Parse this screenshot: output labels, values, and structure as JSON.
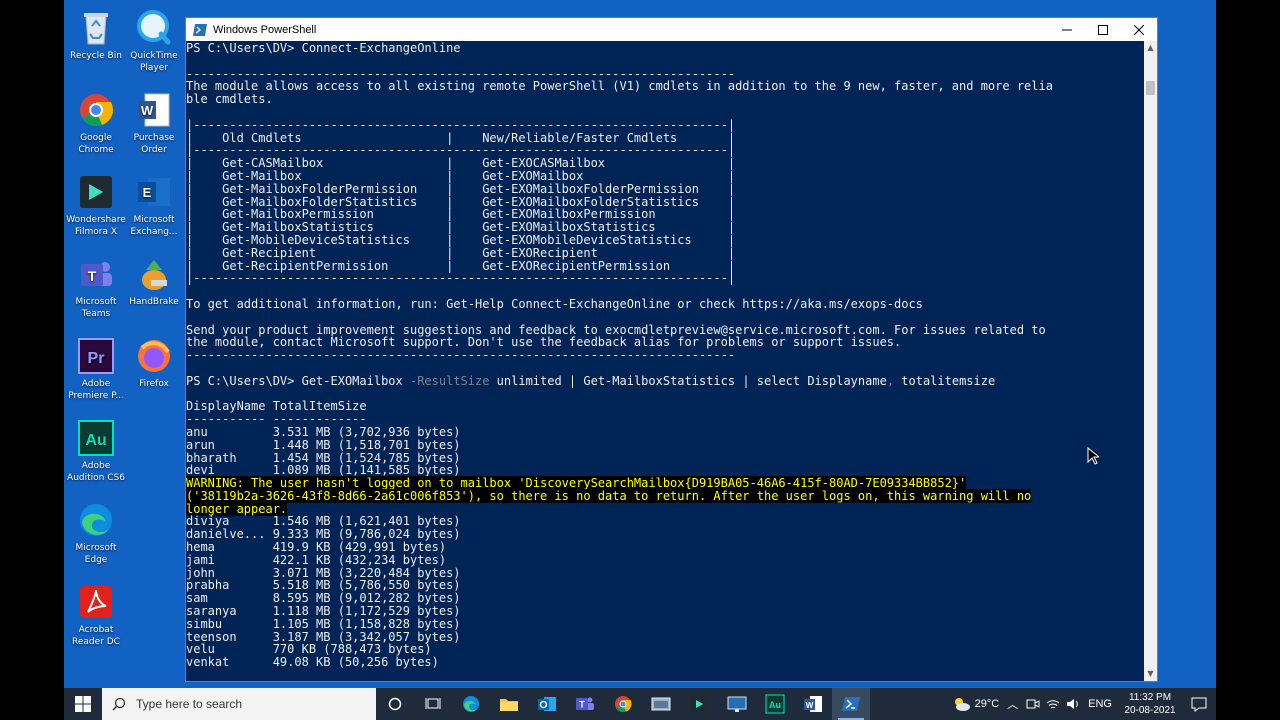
{
  "desktop": {
    "icons": [
      {
        "label": "Recycle Bin"
      },
      {
        "label": "QuickTime Player"
      },
      {
        "label": "Google Chrome"
      },
      {
        "label": "Purchase Order"
      },
      {
        "label": "Wondershare Filmora X"
      },
      {
        "label": "Microsoft Exchang..."
      },
      {
        "label": "Microsoft Teams"
      },
      {
        "label": "HandBrake"
      },
      {
        "label": "Adobe Premiere P..."
      },
      {
        "label": "Firefox"
      },
      {
        "label": "Adobe Audition CS6"
      },
      {
        "label": "Microsoft Edge"
      },
      {
        "label": "Acrobat Reader DC"
      }
    ]
  },
  "window": {
    "title": "Windows PowerShell",
    "minimize": "–",
    "maximize": "☐",
    "close": "✕"
  },
  "console": {
    "prompt1": "PS C:\\Users\\DV> Connect-ExchangeOnline",
    "dash_line": "----------------------------------------------------------------------------",
    "module_info_1": "The module allows access to all existing remote PowerShell (V1) cmdlets in addition to the 9 new, faster, and more relia",
    "module_info_2": "ble cmdlets.",
    "table_border": "|--------------------------------------------------------------------------|",
    "table_header": "|    Old Cmdlets                    |    New/Reliable/Faster Cmdlets       |",
    "table_rows": [
      "|    Get-CASMailbox                 |    Get-EXOCASMailbox                 |",
      "|    Get-Mailbox                    |    Get-EXOMailbox                    |",
      "|    Get-MailboxFolderPermission    |    Get-EXOMailboxFolderPermission    |",
      "|    Get-MailboxFolderStatistics    |    Get-EXOMailboxFolderStatistics    |",
      "|    Get-MailboxPermission          |    Get-EXOMailboxPermission          |",
      "|    Get-MailboxStatistics          |    Get-EXOMailboxStatistics          |",
      "|    Get-MobileDeviceStatistics     |    Get-EXOMobileDeviceStatistics     |",
      "|    Get-Recipient                  |    Get-EXORecipient                  |",
      "|    Get-RecipientPermission        |    Get-EXORecipientPermission        |"
    ],
    "help_line": "To get additional information, run: Get-Help Connect-ExchangeOnline or check https://aka.ms/exops-docs",
    "feedback_1": "Send your product improvement suggestions and feedback to exocmdletpreview@service.microsoft.com. For issues related to",
    "feedback_2": "the module, contact Microsoft support. Don't use the feedback alias for problems or support issues.",
    "prompt2_a": "PS C:\\Users\\DV> Get-EXOMailbox ",
    "prompt2_param": "-ResultSize",
    "prompt2_b": " unlimited | Get-MailboxStatistics | select Displayname",
    "prompt2_comma": ",",
    "prompt2_c": " totalitemsize",
    "col_header": "DisplayName TotalItemSize",
    "col_underline": "----------- -------------",
    "rows_before": [
      "anu         3.531 MB (3,702,936 bytes)",
      "arun        1.448 MB (1,518,701 bytes)",
      "bharath     1.454 MB (1,524,785 bytes)",
      "devi        1.089 MB (1,141,585 bytes)"
    ],
    "warning_1": "WARNING: The user hasn't logged on to mailbox 'DiscoverySearchMailbox{D919BA05-46A6-415f-80AD-7E09334BB852}'",
    "warning_2": "('38119b2a-3626-43f8-8d66-2a61c006f853'), so there is no data to return. After the user logs on, this warning will no",
    "warning_3": "longer appear.",
    "rows_after": [
      "diviya      1.546 MB (1,621,401 bytes)",
      "danielve... 9.333 MB (9,786,024 bytes)",
      "hema        419.9 KB (429,991 bytes)",
      "jami        422.1 KB (432,234 bytes)",
      "john        3.071 MB (3,220,484 bytes)",
      "prabha      5.518 MB (5,786,550 bytes)",
      "sam         8.595 MB (9,012,282 bytes)",
      "saranya     1.118 MB (1,172,529 bytes)",
      "simbu       1.105 MB (1,158,828 bytes)",
      "teenson     3.187 MB (3,342,057 bytes)",
      "velu        770 KB (788,473 bytes)",
      "venkat      49.08 KB (50,256 bytes)"
    ],
    "cursor_glyph": "_"
  },
  "taskbar": {
    "search_placeholder": "Type here to search",
    "weather": "29°C",
    "language": "ENG",
    "time": "11:32 PM",
    "date": "20-08-2021"
  },
  "colors": {
    "desktop_bg": "#1262c4",
    "console_bg": "#012456",
    "console_fg": "#eeedf0",
    "warning_fg": "#ffff00",
    "taskbar_bg": "#1f2b3a"
  }
}
